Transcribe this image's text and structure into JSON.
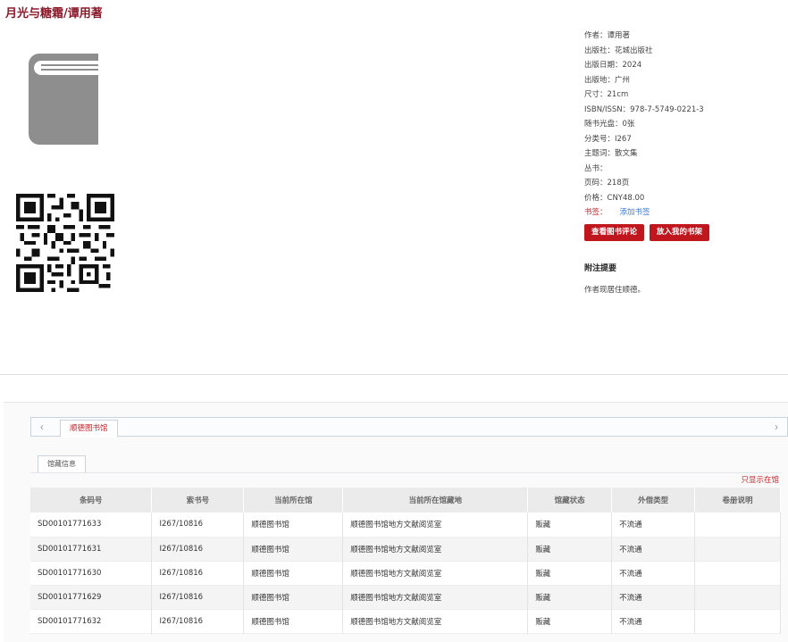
{
  "book": {
    "title": "月光与糖霜/谭用著"
  },
  "info": {
    "rows": [
      {
        "k": "作者：",
        "v": "谭用著"
      },
      {
        "k": "出版社：",
        "v": "花城出版社"
      },
      {
        "k": "出版日期：",
        "v": "2024"
      },
      {
        "k": "出版地：",
        "v": "广州"
      },
      {
        "k": "尺寸：",
        "v": "21cm"
      },
      {
        "k": "ISBN/ISSN：",
        "v": "978-7-5749-0221-3"
      },
      {
        "k": "随书光盘：",
        "v": "0张"
      },
      {
        "k": "分类号：",
        "v": "I267"
      },
      {
        "k": "主题词：",
        "v": "散文集"
      },
      {
        "k": "丛书：",
        "v": ""
      },
      {
        "k": "页码：",
        "v": "218页"
      },
      {
        "k": "价格：",
        "v": "CNY48.00"
      }
    ],
    "tag_label": "书签：",
    "add_tag": "添加书签"
  },
  "buttons": {
    "review": "查看图书评论",
    "shelf": "放入我的书架"
  },
  "note": {
    "heading": "附注提要",
    "text": "作者现居住顺德。"
  },
  "holdings": {
    "library_tab": "顺德图书馆",
    "sub_tab": "馆藏信息",
    "only_show": "只显示在馆",
    "headers": [
      "条码号",
      "索书号",
      "当前所在馆",
      "当前所在馆藏地",
      "馆藏状态",
      "外借类型",
      "卷册说明"
    ],
    "rows": [
      [
        "SD00101771633",
        "I267/10816",
        "顺德图书馆",
        "顺德图书馆地方文献阅览室",
        "贩藏",
        "不流通",
        ""
      ],
      [
        "SD00101771631",
        "I267/10816",
        "顺德图书馆",
        "顺德图书馆地方文献阅览室",
        "贩藏",
        "不流通",
        ""
      ],
      [
        "SD00101771630",
        "I267/10816",
        "顺德图书馆",
        "顺德图书馆地方文献阅览室",
        "贩藏",
        "不流通",
        ""
      ],
      [
        "SD00101771629",
        "I267/10816",
        "顺德图书馆",
        "顺德图书馆地方文献阅览室",
        "贩藏",
        "不流通",
        ""
      ],
      [
        "SD00101771632",
        "I267/10816",
        "顺德图书馆",
        "顺德图书馆地方文献阅览室",
        "贩藏",
        "不流通",
        ""
      ]
    ]
  },
  "colors": {
    "brand_red": "#c0161e",
    "title_red": "#8b1a2b",
    "link_blue": "#3a7ad6"
  },
  "icons": {
    "cover": "book-icon",
    "qr": "qr-code-icon"
  }
}
